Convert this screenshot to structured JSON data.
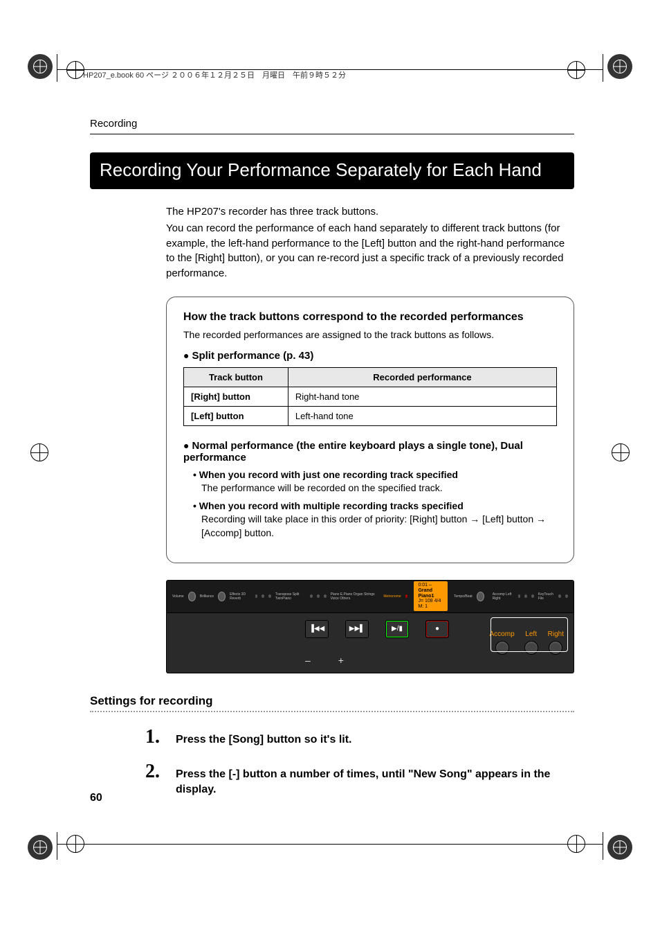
{
  "header_note": "HP207_e.book  60 ページ  ２００６年１２月２５日　月曜日　午前９時５２分",
  "section_label": "Recording",
  "page_title": "Recording Your Performance Separately for Each Hand",
  "intro_line1": "The HP207's recorder has three track buttons.",
  "intro_line2": "You can record the performance of each hand separately to different track buttons (for example, the left-hand performance to the [Left] button and the right-hand performance to the [Right] button), or you can re-record just a specific track of a previously recorded performance.",
  "info": {
    "heading": "How the track buttons correspond to the recorded performances",
    "desc": "The recorded performances are assigned to the track buttons as follows.",
    "split_heading": "Split performance (p. 43)",
    "table": {
      "headers": [
        "Track button",
        "Recorded performance"
      ],
      "rows": [
        [
          "[Right] button",
          "Right-hand tone"
        ],
        [
          "[Left] button",
          "Left-hand tone"
        ]
      ]
    },
    "normal_heading": "Normal performance (the entire keyboard plays a single tone), Dual performance",
    "sub1_title": "When you record with just one recording track specified",
    "sub1_text": "The performance will be recorded on the specified track.",
    "sub2_title": "When you record with multiple recording tracks specified",
    "sub2_text": "Recording will take place in this order of priority: [Right] button → [Left] button → [Accomp] button."
  },
  "panel": {
    "lcd_line1": "0:01 –",
    "lcd_line2": "Grand Piano1",
    "lcd_line3": "J= 108     4/4  M:   1",
    "tracks": [
      "Accomp",
      "Left",
      "Right"
    ]
  },
  "subsection": "Settings for recording",
  "steps": [
    {
      "num": "1.",
      "text": "Press the [Song] button so it's lit."
    },
    {
      "num": "2.",
      "text": "Press the [-] button a number of times, until \"New Song\" appears in the display."
    }
  ],
  "page_number": "60"
}
